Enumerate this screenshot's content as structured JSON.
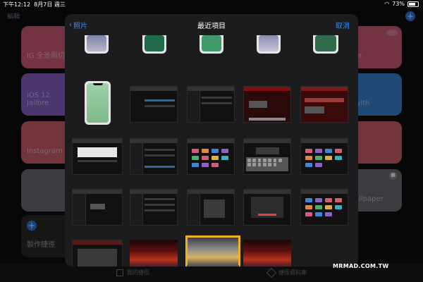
{
  "status_bar": {
    "time": "下午12:12",
    "date": "8月7日 週三",
    "battery": "73%"
  },
  "background_app": {
    "top_left": "編輯",
    "cards": [
      {
        "label": "IG 全景照切割"
      },
      {
        "label": "iOS 12 Jailbre"
      },
      {
        "label": "Instagram 九"
      },
      {
        "label": ""
      },
      {
        "label": "er"
      },
      {
        "label": "with"
      },
      {
        "label": "allpaper"
      }
    ],
    "create_label": "製作捷徑",
    "tabs": [
      "我的捷徑",
      "捷徑資料庫"
    ]
  },
  "picker": {
    "back_label": "照片",
    "title": "最近項目",
    "cancel_label": "取消"
  },
  "watermark": "MRMAD.COM.TW",
  "colors": {
    "accent": "#3d8ef0",
    "selection": "#f2b01e"
  }
}
